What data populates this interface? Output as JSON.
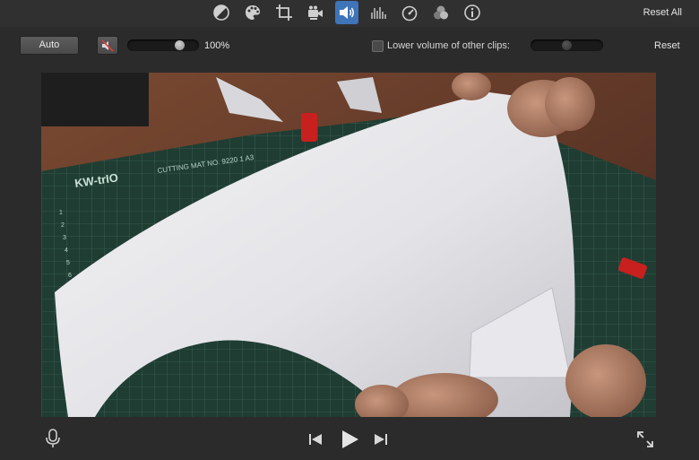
{
  "toolbar": {
    "tools": [
      {
        "name": "color-balance-icon"
      },
      {
        "name": "color-correction-icon"
      },
      {
        "name": "crop-icon"
      },
      {
        "name": "stabilization-icon"
      },
      {
        "name": "volume-icon",
        "active": true
      },
      {
        "name": "noise-reduction-equalizer-icon"
      },
      {
        "name": "speed-icon"
      },
      {
        "name": "clip-filter-icon"
      },
      {
        "name": "info-icon"
      }
    ],
    "reset_all_label": "Reset All",
    "active_color": "#3f74b8"
  },
  "audio": {
    "auto_label": "Auto",
    "mute_icon": "speaker-mute-icon",
    "volume_level": 0.78,
    "volume_text": "100%",
    "lower_volume_checked": false,
    "lower_volume_label": "Lower volume of other clips:",
    "lower_volume_level": 0.5,
    "reset_label": "Reset"
  },
  "playback": {
    "mic_icon": "microphone-icon",
    "prev_icon": "skip-back-icon",
    "play_icon": "play-icon",
    "next_icon": "skip-forward-icon",
    "fullscreen_icon": "fullscreen-icon"
  },
  "viewer": {
    "cutting_mat_brand": "KW-trIO",
    "cutting_mat_text": "CUTTING MAT  NO. 9220 1  A3",
    "mat_numbers": [
      "1",
      "2",
      "3",
      "4",
      "5",
      "6"
    ]
  }
}
